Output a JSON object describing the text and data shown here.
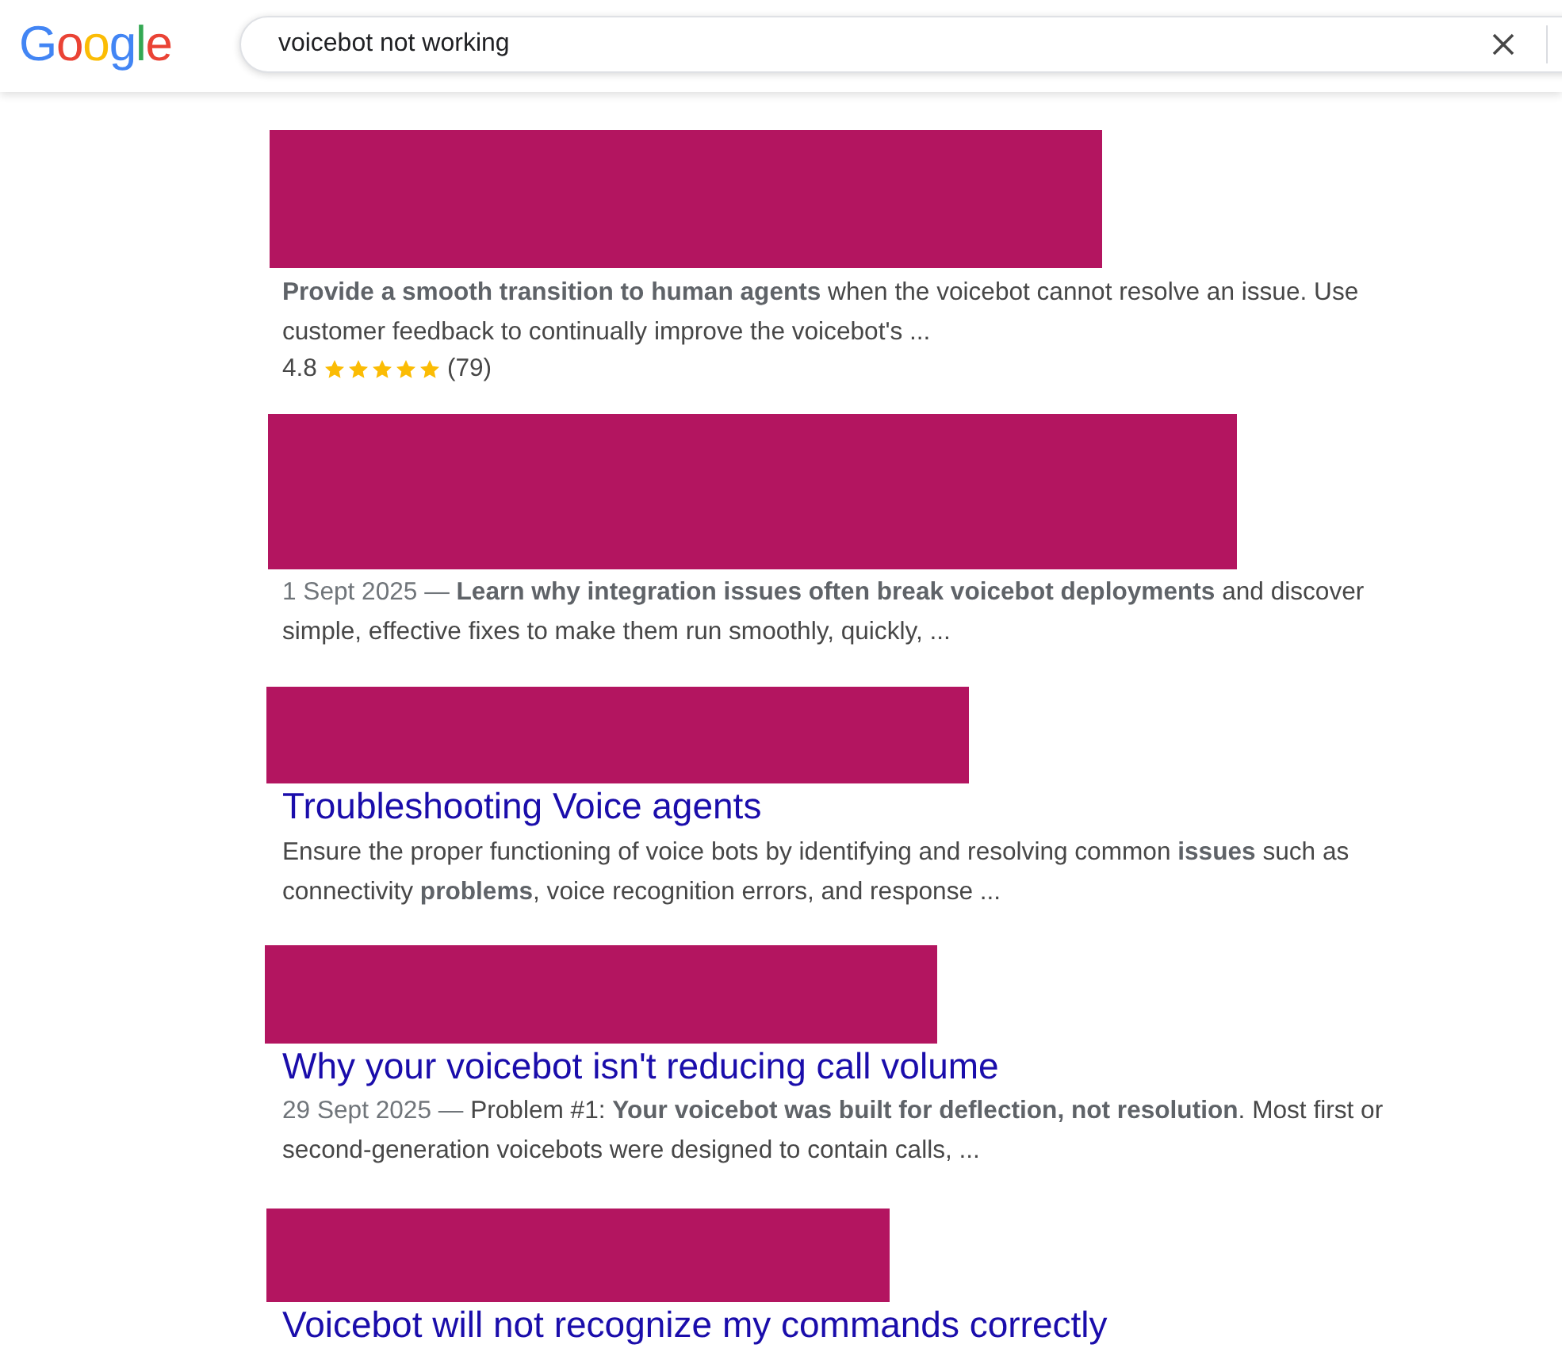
{
  "header": {
    "logo": "Google",
    "search": {
      "value": "voicebot not working"
    }
  },
  "results": [
    {
      "redacted": true,
      "snippet": "**Provide a smooth transition to human agents** when the voicebot cannot resolve an issue. Use customer feedback to continually improve the voicebot's ...",
      "rating": {
        "score": "4.8",
        "stars": 5,
        "count": "(79)"
      }
    },
    {
      "redacted": true,
      "date": "1 Sept 2025 —",
      "snippet": "**Learn why integration issues often break voicebot deployments** and discover simple, effective fixes to make them run smoothly, quickly, ..."
    },
    {
      "redacted": true,
      "title": "Troubleshooting Voice agents",
      "snippet": "Ensure the proper functioning of voice bots by identifying and resolving common **issues** such as connectivity **problems**, voice recognition errors, and response ..."
    },
    {
      "redacted": true,
      "title": "Why your voicebot isn't reducing call volume",
      "date": "29 Sept 2025 —",
      "snippet": "Problem #1: **Your voicebot was built for deflection, not resolution**. Most first or second-generation voicebots were designed to contain calls, ..."
    },
    {
      "redacted": true,
      "title": "Voicebot will not recognize my commands correctly"
    }
  ]
}
